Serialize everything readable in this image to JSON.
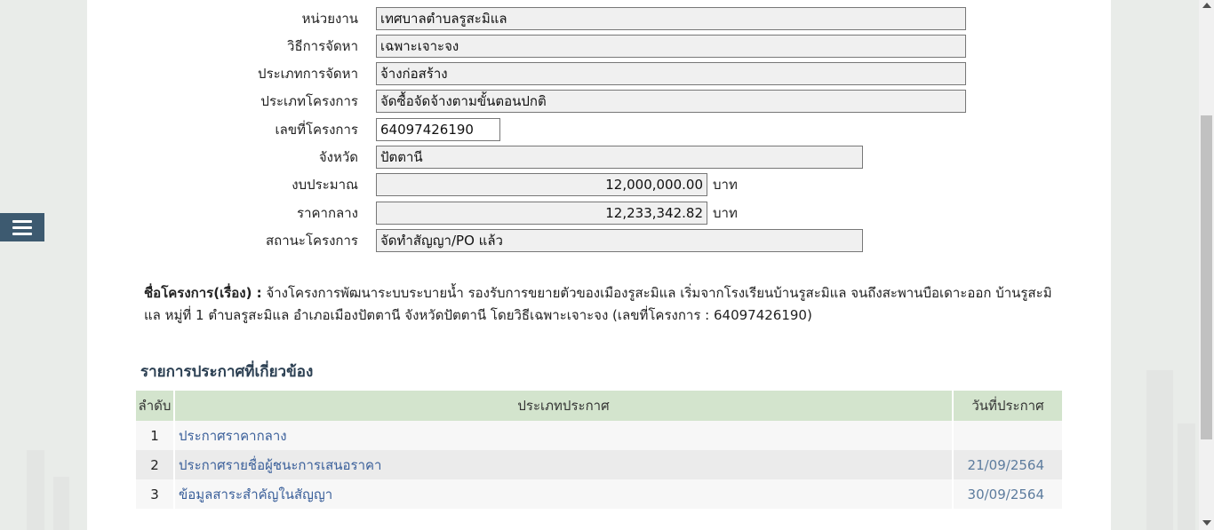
{
  "form": {
    "rows": [
      {
        "label": "หน่วยงาน",
        "value": "เทศบาลตำบลรูสะมิแล"
      },
      {
        "label": "วิธีการจัดหา",
        "value": "เฉพาะเจาะจง"
      },
      {
        "label": "ประเภทการจัดหา",
        "value": "จ้างก่อสร้าง"
      },
      {
        "label": "ประเภทโครงการ",
        "value": "จัดซื้อจัดจ้างตามขั้นตอนปกติ"
      },
      {
        "label": "เลขที่โครงการ",
        "value": "64097426190"
      },
      {
        "label": "จังหวัด",
        "value": "ปัตตานี"
      },
      {
        "label": "งบประมาณ",
        "value": "12,000,000.00",
        "unit": "บาท"
      },
      {
        "label": "ราคากลาง",
        "value": "12,233,342.82",
        "unit": "บาท"
      },
      {
        "label": "สถานะโครงการ",
        "value": "จัดทำสัญญา/PO แล้ว"
      }
    ]
  },
  "project": {
    "label": "ชื่อโครงการ(เรื่อง) :",
    "name": "จ้างโครงการพัฒนาระบบระบายน้ำ รองรับการขยายตัวของเมืองรูสะมิแล เริ่มจากโรงเรียนบ้านรูสะมิแล จนถึงสะพานบือเดาะออก บ้านรูสะมิแล หมู่ที่ 1 ตำบลรูสะมิแล อำเภอเมืองปัตตานี จังหวัดปัตตานี โดยวิธีเฉพาะเจาะจง (เลขที่โครงการ : 64097426190)"
  },
  "announcements": {
    "title": "รายการประกาศที่เกี่ยวข้อง",
    "headers": {
      "index": "ลำดับ",
      "type": "ประเภทประกาศ",
      "date": "วันที่ประกาศ"
    },
    "rows": [
      {
        "index": "1",
        "type": "ประกาศราคากลาง",
        "date": ""
      },
      {
        "index": "2",
        "type": "ประกาศรายชื่อผู้ชนะการเสนอราคา",
        "date": "21/09/2564"
      },
      {
        "index": "3",
        "type": "ข้อมูลสาระสำคัญในสัญญา",
        "date": "30/09/2564"
      }
    ]
  },
  "icons": {
    "menu": "hamburger-menu-icon"
  },
  "colors": {
    "header_bg": "#d3e4cd",
    "link": "#3a5f9a",
    "menu_bg": "#3d5a70"
  }
}
